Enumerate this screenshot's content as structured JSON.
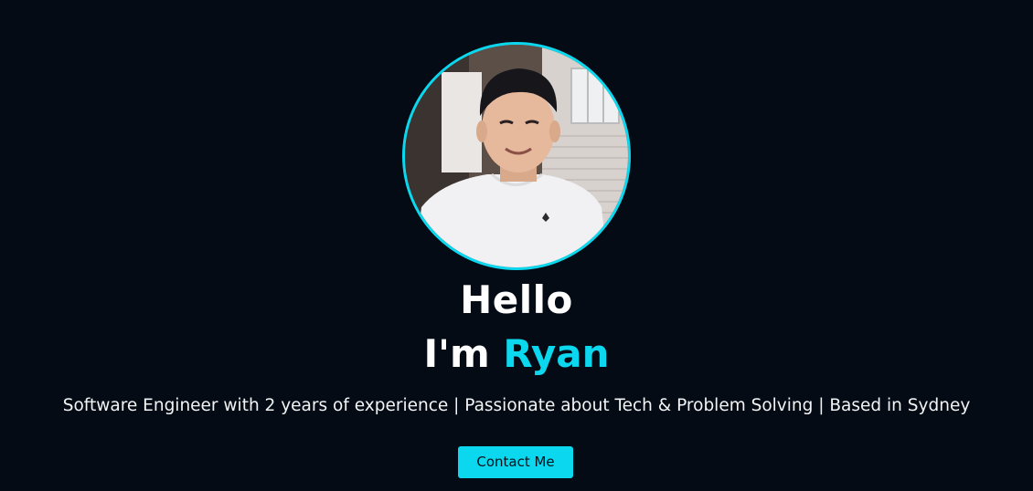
{
  "hero": {
    "greeting": "Hello",
    "intro_prefix": "I'm ",
    "name": "Ryan",
    "tagline": "Software Engineer with 2 years of experience | Passionate about Tech & Problem Solving | Based in Sydney",
    "contact_label": "Contact Me",
    "avatar_icon": "profile-photo"
  },
  "colors": {
    "background": "#050b14",
    "accent": "#0bd7ee",
    "text": "#ffffff"
  }
}
